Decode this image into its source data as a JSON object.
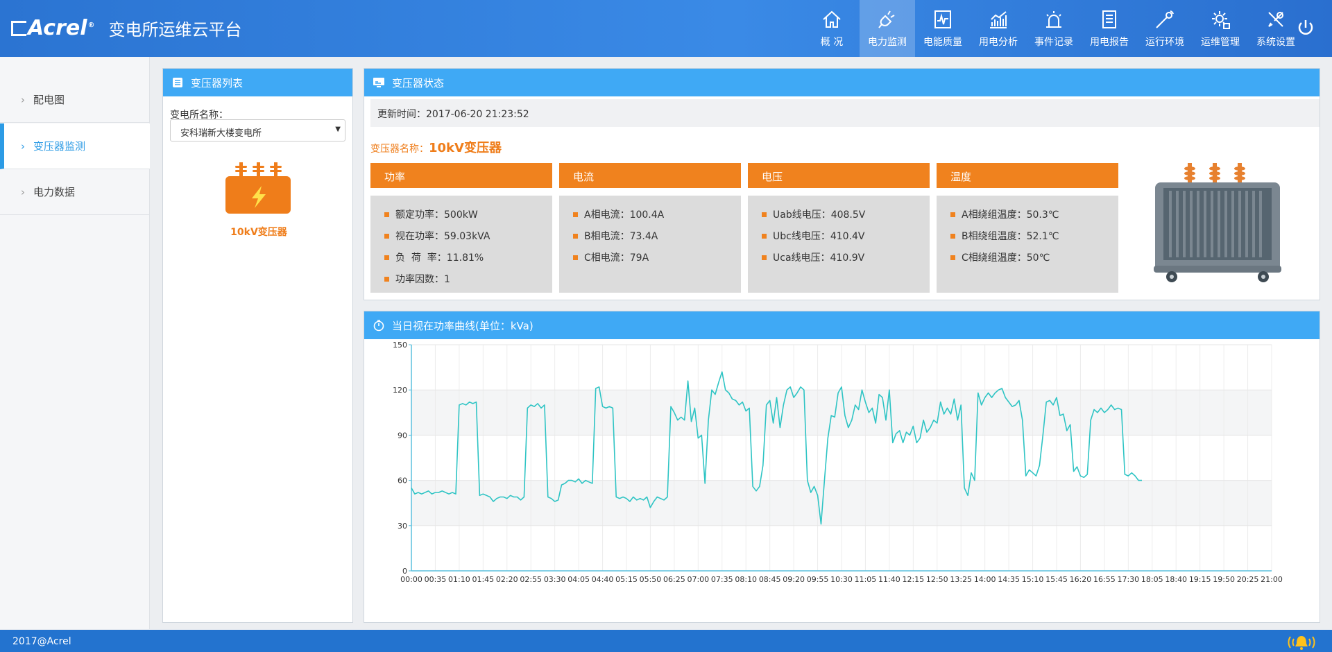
{
  "header": {
    "logo_text": "Acrel",
    "logo_registered": "®",
    "title": "变电所运维云平台",
    "nav": [
      {
        "label": "概 况",
        "icon": "home-icon"
      },
      {
        "label": "电力监测",
        "icon": "plug-icon",
        "active": true
      },
      {
        "label": "电能质量",
        "icon": "waveform-icon"
      },
      {
        "label": "用电分析",
        "icon": "bar-chart-icon"
      },
      {
        "label": "事件记录",
        "icon": "alarm-light-icon"
      },
      {
        "label": "用电报告",
        "icon": "report-icon"
      },
      {
        "label": "运行环境",
        "icon": "sensor-icon"
      },
      {
        "label": "运维管理",
        "icon": "gear-settings-icon"
      },
      {
        "label": "系统设置",
        "icon": "tools-icon"
      }
    ]
  },
  "sidebar": {
    "items": [
      {
        "label": "配电图"
      },
      {
        "label": "变压器监测",
        "active": true
      },
      {
        "label": "电力数据"
      }
    ]
  },
  "list_panel": {
    "title": "变压器列表",
    "substation_label": "变电所名称：",
    "substation_value": "安科瑞新大楼变电所",
    "transformer_name": "10kV变压器"
  },
  "status_panel": {
    "title": "变压器状态",
    "update_label": "更新时间：",
    "update_time": "2017-06-20 21:23:52",
    "name_label": "变压器名称：",
    "name_value": "10kV变压器",
    "metrics": [
      {
        "title": "功率",
        "rows": [
          "额定功率：500kW",
          "视在功率：59.03kVA",
          "负  荷  率：11.81%",
          "功率因数：1"
        ]
      },
      {
        "title": "电流",
        "rows": [
          "A相电流：100.4A",
          "B相电流：73.4A",
          "C相电流：79A"
        ]
      },
      {
        "title": "电压",
        "rows": [
          "Uab线电压：408.5V",
          "Ubc线电压：410.4V",
          "Uca线电压：410.9V"
        ]
      },
      {
        "title": "温度",
        "rows": [
          "A相绕组温度：50.3℃",
          "B相绕组温度：52.1℃",
          "C相绕组温度：50℃"
        ]
      }
    ]
  },
  "chart_panel": {
    "title": "当日视在功率曲线(单位：kVa)"
  },
  "chart_data": {
    "type": "line",
    "title": "当日视在功率曲线(单位：kVa)",
    "xlabel": "",
    "ylabel": "",
    "ylim": [
      0,
      150
    ],
    "yticks": [
      0,
      30,
      60,
      90,
      120,
      150
    ],
    "xticks": [
      "00:00",
      "00:35",
      "01:10",
      "01:45",
      "02:20",
      "02:55",
      "03:30",
      "04:05",
      "04:40",
      "05:15",
      "05:50",
      "06:25",
      "07:00",
      "07:35",
      "08:10",
      "08:45",
      "09:20",
      "09:55",
      "10:30",
      "11:05",
      "11:40",
      "12:15",
      "12:50",
      "13:25",
      "14:00",
      "14:35",
      "15:10",
      "15:45",
      "16:20",
      "16:55",
      "17:30",
      "18:05",
      "18:40",
      "19:15",
      "19:50",
      "20:25",
      "21:00"
    ],
    "grid": true,
    "color": "#2ec4c4",
    "series": [
      {
        "interval_minutes": 5,
        "values": [
          55,
          51,
          52,
          51,
          52,
          53,
          51,
          52,
          52,
          53,
          52,
          51,
          52,
          51,
          110,
          111,
          110,
          112,
          111,
          112,
          50,
          51,
          50,
          49,
          46,
          48,
          49,
          49,
          48,
          50,
          49,
          49,
          47,
          49,
          108,
          110,
          109,
          111,
          108,
          110,
          49,
          48,
          46,
          47,
          57,
          58,
          60,
          60,
          59,
          61,
          58,
          60,
          59,
          58,
          121,
          122,
          109,
          108,
          109,
          108,
          49,
          48,
          49,
          48,
          46,
          49,
          47,
          48,
          47,
          49,
          42,
          46,
          49,
          48,
          47,
          49,
          109,
          105,
          100,
          102,
          100,
          126,
          99,
          108,
          88,
          90,
          58,
          100,
          120,
          117,
          125,
          132,
          120,
          118,
          114,
          113,
          110,
          112,
          106,
          108,
          56,
          53,
          56,
          70,
          110,
          113,
          98,
          115,
          95,
          110,
          120,
          122,
          115,
          118,
          122,
          120,
          60,
          52,
          56,
          50,
          31,
          60,
          88,
          103,
          102,
          118,
          122,
          103,
          95,
          100,
          110,
          107,
          120,
          112,
          105,
          108,
          98,
          117,
          115,
          100,
          120,
          85,
          91,
          93,
          85,
          92,
          90,
          96,
          85,
          88,
          100,
          92,
          95,
          100,
          98,
          112,
          104,
          108,
          104,
          114,
          100,
          110,
          55,
          50,
          65,
          60,
          118,
          110,
          115,
          118,
          115,
          118,
          120,
          121,
          115,
          112,
          109,
          110,
          113,
          100,
          63,
          67,
          65,
          63,
          70,
          90,
          112,
          113,
          110,
          115,
          103,
          104,
          93,
          97,
          66,
          69,
          63,
          62,
          64,
          100,
          107,
          105,
          108,
          105,
          107,
          110,
          107,
          108,
          107,
          64,
          63,
          65,
          63,
          60,
          60
        ]
      }
    ]
  },
  "footer": {
    "copyright": "2017@Acrel"
  },
  "colors": {
    "header_blue": "#2b74d2",
    "panel_head_blue": "#3fa9f5",
    "metric_orange": "#f0821e",
    "line_teal": "#2ec4c4",
    "footer_blue": "#2373cf"
  }
}
